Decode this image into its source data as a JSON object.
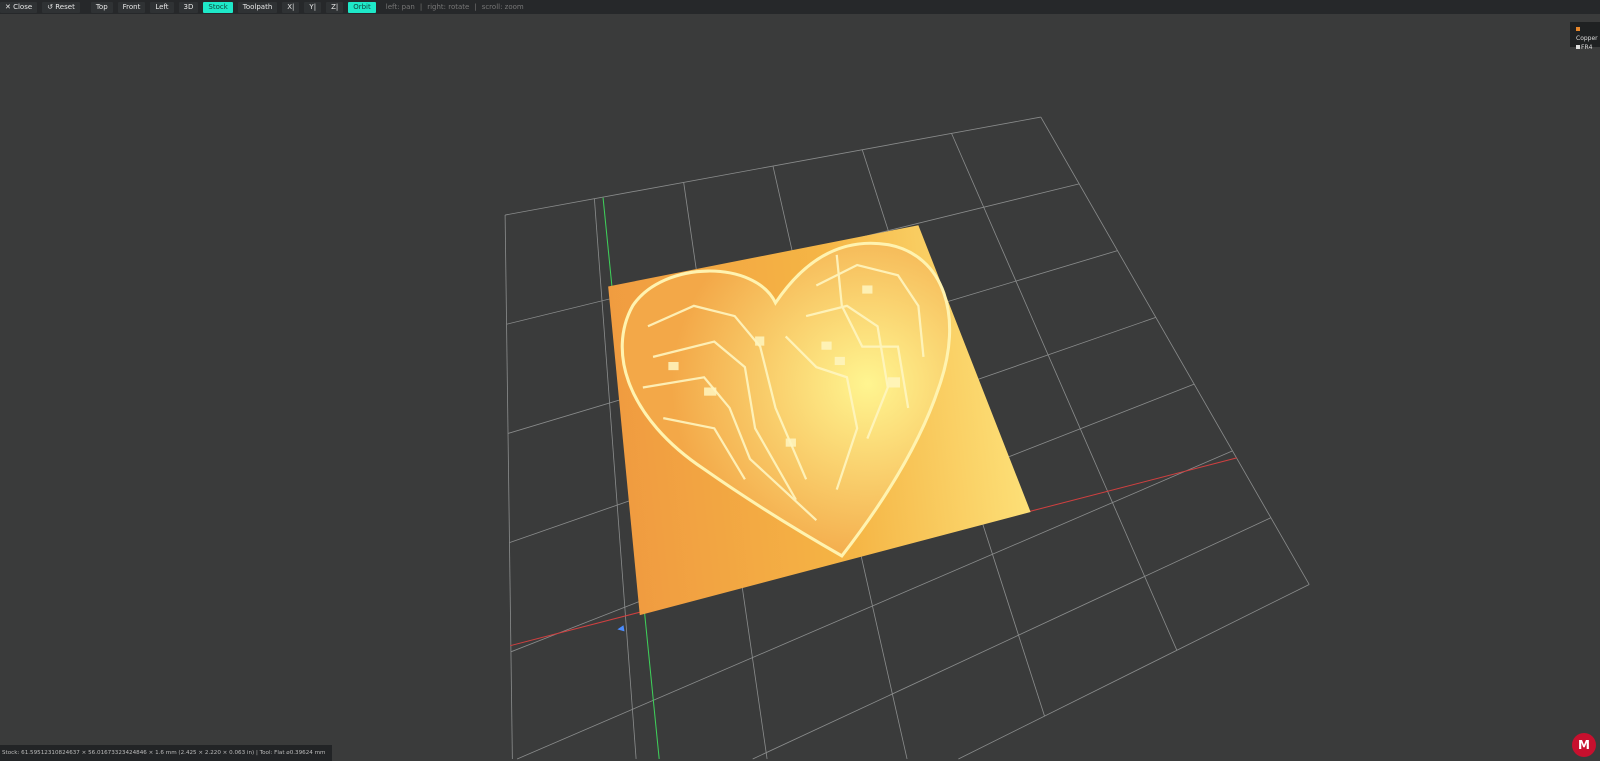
{
  "toolbar": {
    "close": "✕ Close",
    "reset": "↺ Reset",
    "views": [
      "Top",
      "Front",
      "Left",
      "3D"
    ],
    "stock": "Stock",
    "toolpath": "Toolpath",
    "axes": [
      "X|",
      "Y|",
      "Z|"
    ],
    "orbit": "Orbit",
    "hints": [
      "left: pan",
      "right: rotate",
      "scroll: zoom"
    ]
  },
  "legend": [
    {
      "label": "Copper",
      "color": "#e8872a"
    },
    {
      "label": "FR4",
      "color": "#dddddd"
    }
  ],
  "status": "Stock: 61.59512310824637 × 56.01673323424846 × 1.6 mm (2.425 × 2.220 × 0.063 in) | Tool: Flat ⌀0.39624 mm",
  "colors": {
    "accent": "#1ee8c8",
    "stock": "#f0a040",
    "grid": "#8a8c8c"
  }
}
